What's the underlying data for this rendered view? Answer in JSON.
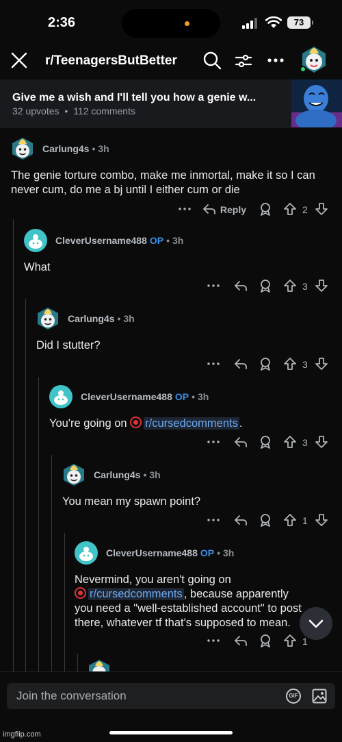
{
  "status_bar": {
    "time": "2:36",
    "battery": "73"
  },
  "header": {
    "subreddit": "r/TeenagersButBetter"
  },
  "post": {
    "title": "Give me a wish and I'll tell you how a genie w...",
    "upvotes": "32 upvotes",
    "comments": "112 comments",
    "separator": "•"
  },
  "labels": {
    "reply": "Reply",
    "op": "OP",
    "dot": "•"
  },
  "comments": [
    {
      "user": "Carlung4s",
      "time": "3h",
      "op": false,
      "body": "The genie torture combo, make me inmortal, make it so I can never cum, do me a bj until I either cum or die",
      "votes": "2",
      "show_reply_label": true
    },
    {
      "user": "CleverUsername488",
      "time": "3h",
      "op": true,
      "body": "What",
      "votes": "3"
    },
    {
      "user": "Carlung4s",
      "time": "3h",
      "op": false,
      "body": "Did I stutter?",
      "votes": "3"
    },
    {
      "user": "CleverUsername488",
      "time": "3h",
      "op": true,
      "body_pre": "You're going on ",
      "link": "r/cursedcomments",
      "body_post": ".",
      "votes": "3"
    },
    {
      "user": "Carlung4s",
      "time": "3h",
      "op": false,
      "body": "You mean my spawn point?",
      "votes": "1"
    },
    {
      "user": "CleverUsername488",
      "time": "3h",
      "op": true,
      "body_line1": "Nevermind, you aren't going on",
      "link": "r/cursedcomments",
      "body_line2_post": ", because apparently",
      "body_line3": "you need a \"well-established account\" to post",
      "body_line4": "there, whatever tf that's supposed to mean.",
      "votes": "1"
    }
  ],
  "composer": {
    "placeholder": "Join the conversation",
    "gif": "GIF"
  },
  "watermark": "imgflip.com",
  "colors": {
    "accent_op": "#3a8fe8",
    "link": "#6aa8f0",
    "online": "#3bd16f"
  }
}
